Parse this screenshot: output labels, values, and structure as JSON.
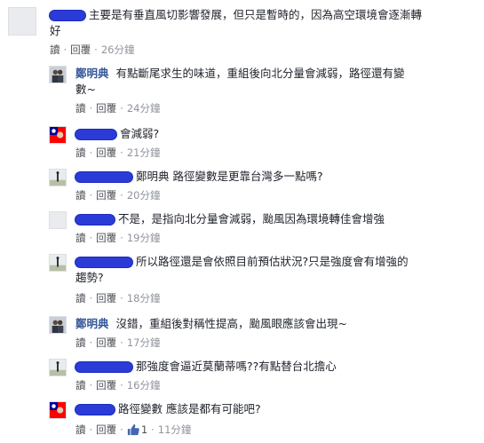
{
  "labels": {
    "reply": "讀",
    "response": "回覆"
  },
  "comments": [
    {
      "author": "",
      "text_lines": [
        "主要是有垂直風切影響發展，但只是暫時的，因為高空環境會逐漸轉",
        "好"
      ],
      "time": "26分鐘",
      "avatar": "blank",
      "scribble": true
    },
    {
      "author": "鄭明典",
      "text_lines": [
        "有點斷尾求生的味道，重組後向北分量會減弱，路徑還有變",
        "數~"
      ],
      "time": "24分鐘",
      "avatar": "photo-two-people"
    },
    {
      "author": "",
      "text_lines": [
        "會減弱?"
      ],
      "time": "21分鐘",
      "avatar": "flag",
      "scribble": true
    },
    {
      "author": "",
      "text_lines": [
        "鄭明典 路徑變數是更靠台灣多一點嗎?"
      ],
      "time": "20分鐘",
      "avatar": "landscape",
      "scribble": true
    },
    {
      "author": "",
      "text_lines": [
        "不是，是指向北分量會減弱，颱風因為環境轉佳會增強"
      ],
      "time": "19分鐘",
      "avatar": "blank",
      "scribble": true
    },
    {
      "author": "",
      "text_lines": [
        "所以路徑還是會依照目前預估狀況?只是強度會有增強的",
        "趨勢?"
      ],
      "time": "18分鐘",
      "avatar": "landscape",
      "scribble": true
    },
    {
      "author": "鄭明典",
      "text_lines": [
        "沒錯，重組後對稱性提高，颱風眼應該會出現~"
      ],
      "time": "17分鐘",
      "avatar": "photo-two-people"
    },
    {
      "author": "",
      "text_lines": [
        "那強度會逼近莫蘭蒂嗎??有點替台北擔心"
      ],
      "time": "16分鐘",
      "avatar": "landscape",
      "scribble": true
    },
    {
      "author": "",
      "text_lines": [
        "路徑變數 應該是都有可能吧?"
      ],
      "time": "11分鐘",
      "avatar": "flag",
      "scribble": true,
      "likes": "1"
    }
  ],
  "colors": {
    "author": "#365899",
    "meta": "#90949c",
    "scribble": "#2a3bd6"
  }
}
